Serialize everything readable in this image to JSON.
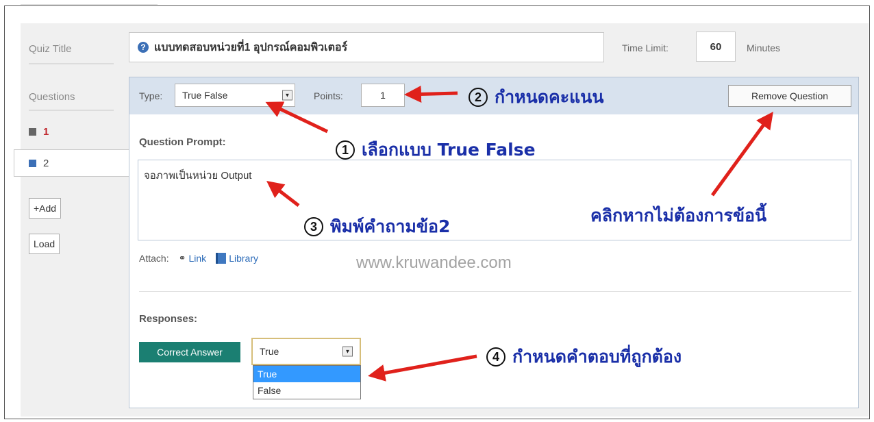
{
  "quiz": {
    "title_label": "Quiz Title",
    "title_value": "แบบทดสอบหน่วยที่1 อุปกรณ์คอมพิวเตอร์",
    "time_limit_label": "Time Limit:",
    "time_limit_value": "60",
    "minutes_label": "Minutes"
  },
  "sidebar": {
    "questions_label": "Questions",
    "items": [
      {
        "label": "1",
        "color": "#666666"
      },
      {
        "label": "2",
        "color": "#3b6fb6"
      }
    ],
    "add_label": "+Add",
    "load_label": "Load"
  },
  "question": {
    "type_label": "Type:",
    "type_value": "True False",
    "points_label": "Points:",
    "points_value": "1",
    "remove_label": "Remove Question",
    "prompt_label": "Question Prompt:",
    "prompt_text": "จอภาพเป็นหน่วย Output",
    "attach_label": "Attach:",
    "link_label": "Link",
    "library_label": "Library",
    "responses_label": "Responses:",
    "correct_answer_label": "Correct Answer",
    "answer_value": "True",
    "answer_options": [
      "True",
      "False"
    ]
  },
  "annotations": {
    "step1": {
      "num": "1",
      "text": "เลือกแบบ True False"
    },
    "step2": {
      "num": "2",
      "text": "กำหนดคะแนน"
    },
    "step3": {
      "num": "3",
      "text": "พิมพ์คำถามข้อ2"
    },
    "step4": {
      "num": "4",
      "text": "กำหนดคำตอบที่ถูกต้อง"
    },
    "remove_hint": "คลิกหากไม่ต้องการข้อนี้"
  },
  "watermark": "www.kruwandee.com",
  "colors": {
    "accent_green": "#1b7f72",
    "arrow_red": "#e0211b",
    "annotation_blue": "#1a2fa8"
  }
}
